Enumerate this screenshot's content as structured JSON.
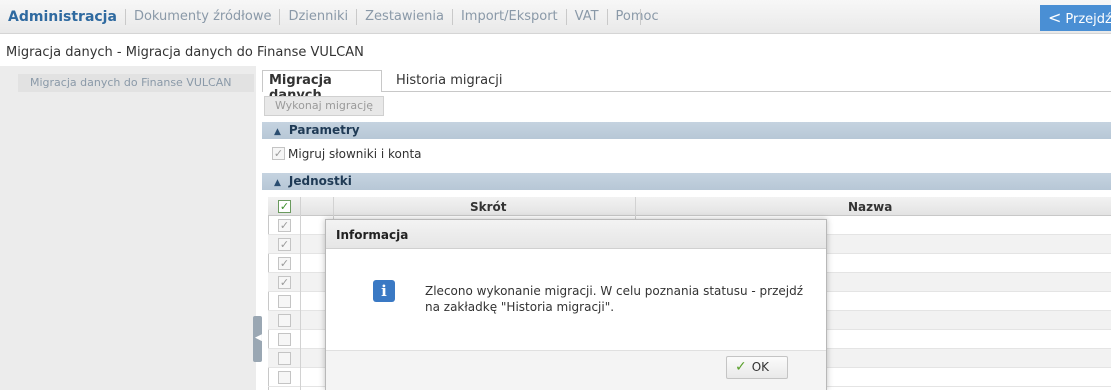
{
  "menu": {
    "items": [
      "Administracja",
      "Dokumenty źródłowe",
      "Dzienniki",
      "Zestawienia",
      "Import/Eksport",
      "VAT",
      "Pomoc"
    ],
    "go_label": "Przejdź"
  },
  "page": {
    "title": "Migracja danych - Migracja danych do Finanse VULCAN"
  },
  "sidebar": {
    "items": [
      {
        "label": "Migracja danych do Finanse VULCAN"
      }
    ]
  },
  "tabs": [
    {
      "label": "Migracja danych"
    },
    {
      "label": "Historia migracji"
    }
  ],
  "toolbar": {
    "execute_label": "Wykonaj migrację"
  },
  "parameters": {
    "title": "Parametry",
    "option_label": "Migruj słowniki i konta",
    "option_checked": true
  },
  "units": {
    "title": "Jednostki",
    "columns": [
      "Skrót",
      "Nazwa"
    ],
    "rows_checked": [
      true,
      true,
      true,
      true,
      false,
      false,
      false,
      false,
      false
    ]
  },
  "dialog": {
    "title": "Informacja",
    "message_line1": "Zlecono wykonanie migracji. W celu poznania statusu - przejdź",
    "message_line2": "na zakładkę \"Historia migracji\".",
    "ok_label": "OK"
  }
}
